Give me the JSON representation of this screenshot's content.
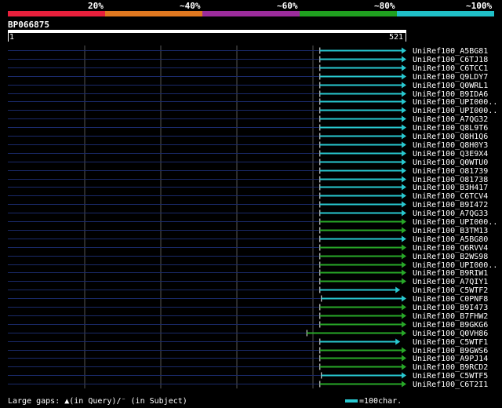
{
  "legend": {
    "segments": [
      {
        "label": "20%",
        "color": "#e8203c"
      },
      {
        "label": "~40%",
        "color": "#e07820"
      },
      {
        "label": "~60%",
        "color": "#9c2c9c"
      },
      {
        "label": "~80%",
        "color": "#20a020"
      },
      {
        "label": "~100%",
        "color": "#20c0c8"
      }
    ]
  },
  "query": {
    "name": "BP066875",
    "start": "1",
    "end": "521"
  },
  "colors": {
    "background": "#000000",
    "grid": "#555555",
    "guide": "#1a2a6a",
    "cyan": "#28c8d0",
    "green": "#28a828",
    "label": "#ffffff"
  },
  "hits": [
    {
      "label": "UniRef100_A5BG81",
      "start": 409,
      "end": 521,
      "color": "cyan"
    },
    {
      "label": "UniRef100_C6TJ18",
      "start": 409,
      "end": 521,
      "color": "cyan"
    },
    {
      "label": "UniRef100_C6TCC1",
      "start": 409,
      "end": 521,
      "color": "cyan"
    },
    {
      "label": "UniRef100_Q9LDY7",
      "start": 409,
      "end": 521,
      "color": "cyan"
    },
    {
      "label": "UniRef100_Q0WRL1",
      "start": 409,
      "end": 521,
      "color": "cyan"
    },
    {
      "label": "UniRef100_B9IDA6",
      "start": 409,
      "end": 521,
      "color": "cyan"
    },
    {
      "label": "UniRef100_UPI000..",
      "start": 409,
      "end": 521,
      "color": "cyan"
    },
    {
      "label": "UniRef100_UPI000..",
      "start": 409,
      "end": 521,
      "color": "cyan"
    },
    {
      "label": "UniRef100_A7QG32",
      "start": 409,
      "end": 521,
      "color": "cyan"
    },
    {
      "label": "UniRef100_Q8L9T6",
      "start": 409,
      "end": 521,
      "color": "cyan"
    },
    {
      "label": "UniRef100_Q8H1Q6",
      "start": 409,
      "end": 521,
      "color": "cyan"
    },
    {
      "label": "UniRef100_Q8H0Y3",
      "start": 409,
      "end": 521,
      "color": "cyan"
    },
    {
      "label": "UniRef100_Q3E9X4",
      "start": 409,
      "end": 521,
      "color": "cyan"
    },
    {
      "label": "UniRef100_Q0WTU0",
      "start": 409,
      "end": 521,
      "color": "cyan"
    },
    {
      "label": "UniRef100_O81739",
      "start": 409,
      "end": 521,
      "color": "cyan"
    },
    {
      "label": "UniRef100_O81738",
      "start": 409,
      "end": 521,
      "color": "cyan"
    },
    {
      "label": "UniRef100_B3H417",
      "start": 409,
      "end": 521,
      "color": "cyan"
    },
    {
      "label": "UniRef100_C6TCV4",
      "start": 409,
      "end": 521,
      "color": "cyan"
    },
    {
      "label": "UniRef100_B9I472",
      "start": 409,
      "end": 521,
      "color": "cyan"
    },
    {
      "label": "UniRef100_A7QG33",
      "start": 409,
      "end": 521,
      "color": "cyan"
    },
    {
      "label": "UniRef100_UPI000..",
      "start": 409,
      "end": 521,
      "color": "green"
    },
    {
      "label": "UniRef100_B3TM13",
      "start": 409,
      "end": 521,
      "color": "green"
    },
    {
      "label": "UniRef100_A5BG80",
      "start": 409,
      "end": 521,
      "color": "cyan"
    },
    {
      "label": "UniRef100_Q6RVV4",
      "start": 409,
      "end": 521,
      "color": "green"
    },
    {
      "label": "UniRef100_B2WS98",
      "start": 409,
      "end": 521,
      "color": "green"
    },
    {
      "label": "UniRef100_UPI000..",
      "start": 409,
      "end": 521,
      "color": "green"
    },
    {
      "label": "UniRef100_B9RIW1",
      "start": 409,
      "end": 521,
      "color": "green"
    },
    {
      "label": "UniRef100_A7QIY1",
      "start": 409,
      "end": 521,
      "color": "green"
    },
    {
      "label": "UniRef100_C5WTF2",
      "start": 409,
      "end": 513,
      "color": "cyan"
    },
    {
      "label": "UniRef100_C0PNF8",
      "start": 411,
      "end": 521,
      "color": "cyan"
    },
    {
      "label": "UniRef100_B9I473",
      "start": 409,
      "end": 521,
      "color": "green"
    },
    {
      "label": "UniRef100_B7FHW2",
      "start": 409,
      "end": 521,
      "color": "green"
    },
    {
      "label": "UniRef100_B9GKG6",
      "start": 409,
      "end": 521,
      "color": "green"
    },
    {
      "label": "UniRef100_Q0VH86",
      "start": 392,
      "end": 521,
      "color": "green"
    },
    {
      "label": "UniRef100_C5WTF1",
      "start": 409,
      "end": 513,
      "color": "cyan"
    },
    {
      "label": "UniRef100_B9GWS6",
      "start": 409,
      "end": 521,
      "color": "green"
    },
    {
      "label": "UniRef100_A9PJ14",
      "start": 409,
      "end": 521,
      "color": "green"
    },
    {
      "label": "UniRef100_B9RCD2",
      "start": 409,
      "end": 521,
      "color": "green"
    },
    {
      "label": "UniRef100_C5WTF5",
      "start": 411,
      "end": 521,
      "color": "cyan"
    },
    {
      "label": "UniRef100_C6T2I1",
      "start": 409,
      "end": 521,
      "color": "green"
    }
  ],
  "footer": {
    "gaps_text": "Large gaps: ▲(in Query)/⁻ (in Subject)",
    "scale_text": "=100char."
  }
}
